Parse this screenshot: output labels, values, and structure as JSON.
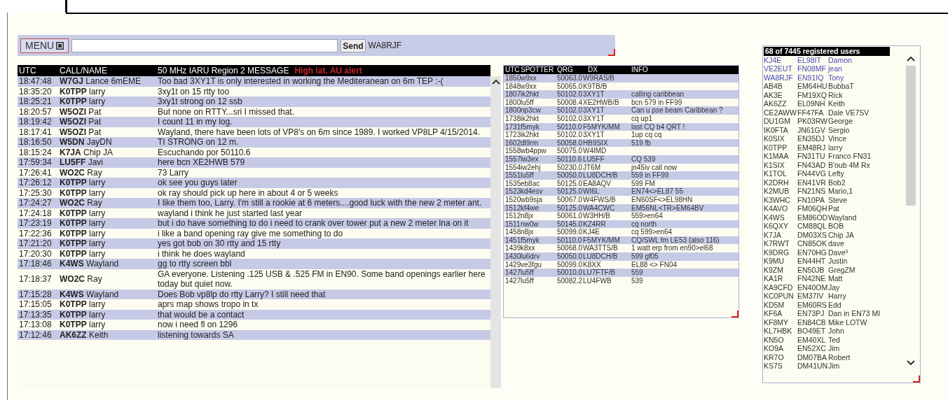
{
  "toolbar": {
    "menu_label": "MENU",
    "send_label": "Send",
    "callsign": "WA8RJF"
  },
  "chat": {
    "columns": [
      "UTC",
      "CALL/NAME",
      "50 MHz IARU Region 2 MESSAGE"
    ],
    "alert": "High lat. AU alert",
    "rows": [
      {
        "utc": "18:47:48",
        "call": "W7GJ",
        "name": "Lance 6mEME",
        "message": "Too bad 3XY1T is only interested in working the Mediteranean on 6m TEP :-("
      },
      {
        "utc": "18:35:20",
        "call": "K0TPP",
        "name": "larry",
        "message": "3xy1t on 15 rtty too"
      },
      {
        "utc": "18:25:21",
        "call": "K0TPP",
        "name": "larry",
        "message": "3xy1t strong on 12 ssb"
      },
      {
        "utc": "18:20:57",
        "call": "W5OZI",
        "name": "Pat",
        "message": "But none on RTTY...sri I missed that."
      },
      {
        "utc": "18:19:42",
        "call": "W5OZI",
        "name": "Pat",
        "message": "I count 11 in my log."
      },
      {
        "utc": "18:17:41",
        "call": "W5OZI",
        "name": "Pat",
        "message": "Wayland, there have been lots of VP8's on 6m since 1989. I worked VP8LP 4/15/2014."
      },
      {
        "utc": "18:16:50",
        "call": "W5DN",
        "name": "JayDN",
        "message": "TI STRONG on 12 m."
      },
      {
        "utc": "18:15:24",
        "call": "K7JA",
        "name": "Chip JA",
        "message": "Escuchando por 50110.6"
      },
      {
        "utc": "17:59:34",
        "call": "LU5FF",
        "name": "Javi",
        "message": "here bcn XE2HWB 579"
      },
      {
        "utc": "17:26:41",
        "call": "WO2C",
        "name": "Ray",
        "message": "73 Larry"
      },
      {
        "utc": "17:26:12",
        "call": "K0TPP",
        "name": "larry",
        "message": "ok see you guys later"
      },
      {
        "utc": "17:25:30",
        "call": "K0TPP",
        "name": "larry",
        "message": "ok ray should pick up here in about 4 or 5 weeks"
      },
      {
        "utc": "17:24:27",
        "call": "WO2C",
        "name": "Ray",
        "message": "I like them too, Larry. I'm still a rookie at 6 meters....good luck with the new 2 meter ant."
      },
      {
        "utc": "17:24:18",
        "call": "K0TPP",
        "name": "larry",
        "message": "wayland i think he just started last year"
      },
      {
        "utc": "17:23:19",
        "call": "K0TPP",
        "name": "larry",
        "message": "but i do have something to do i need to crank over tower put a new 2 meter lna on it"
      },
      {
        "utc": "17:22:36",
        "call": "K0TPP",
        "name": "larry",
        "message": "i like a band opening ray give me something to do"
      },
      {
        "utc": "17:21:20",
        "call": "K0TPP",
        "name": "larry",
        "message": "yes got bob on 30 rtty and 15 rtty"
      },
      {
        "utc": "17:20:30",
        "call": "K0TPP",
        "name": "larry",
        "message": "i think he does wayland"
      },
      {
        "utc": "17:18:46",
        "call": "K4WS",
        "name": "Wayland",
        "message": "gg to rtty screen bbl"
      },
      {
        "utc": "17:18:37",
        "call": "WO2C",
        "name": "Ray",
        "message": "GA everyone. Listening .125 USB & .525 FM in EN90. Some band openings earlier here today but quiet now."
      },
      {
        "utc": "17:15:28",
        "call": "K4WS",
        "name": "Wayland",
        "message": "Does Bob vp8lp do rtty Larry? I still need that"
      },
      {
        "utc": "17:15:05",
        "call": "K0TPP",
        "name": "larry",
        "message": "aprs map shows tropo in tx"
      },
      {
        "utc": "17:13:35",
        "call": "K0TPP",
        "name": "larry",
        "message": "that would be a contact"
      },
      {
        "utc": "17:13:08",
        "call": "K0TPP",
        "name": "larry",
        "message": "now i need fl on 1296"
      },
      {
        "utc": "17:12:46",
        "call": "AK6ZZ",
        "name": "Keith",
        "message": "listening towards SA"
      }
    ]
  },
  "spots": {
    "columns": [
      "UTC",
      "SPOTTER",
      "QRG",
      "DX",
      "INFO"
    ],
    "rows": [
      {
        "utc": "1850",
        "spotter": "w9xx",
        "qrg": "50063.0",
        "dx": "W9RAS/B",
        "info": ""
      },
      {
        "utc": "1848",
        "spotter": "w9xx",
        "qrg": "50065.0",
        "dx": "K9TB/B",
        "info": ""
      },
      {
        "utc": "1807",
        "spotter": "ik2hkt",
        "qrg": "50102.0",
        "dx": "3XY1T",
        "info": "calling caribbean"
      },
      {
        "utc": "1800",
        "spotter": "lu5ff",
        "qrg": "50008.4",
        "dx": "XE2HWB/B",
        "info": "bcn 579 in FF99"
      },
      {
        "utc": "1800",
        "spotter": "np3cw",
        "qrg": "50102.0",
        "dx": "3XY1T",
        "info": "Can u pse beam Caribbean ?"
      },
      {
        "utc": "1738",
        "spotter": "ik2hkt",
        "qrg": "50102.0",
        "dx": "3XY1T",
        "info": "cq up1"
      },
      {
        "utc": "1731",
        "spotter": "f5myk",
        "qrg": "50110.0",
        "dx": "F5MYK/MM",
        "info": "last CQ b4 QRT !"
      },
      {
        "utc": "1723",
        "spotter": "ik2hkt",
        "qrg": "50102.0",
        "dx": "3XY1T",
        "info": "1up cq cq"
      },
      {
        "utc": "1602",
        "spotter": "dl9rm",
        "qrg": "50058.0",
        "dx": "HB9SIX",
        "info": "519 fb"
      },
      {
        "utc": "1558",
        "spotter": "wb4ppw",
        "qrg": "50075.0",
        "dx": "W4IMD",
        "info": ""
      },
      {
        "utc": "1557",
        "spotter": "lw3ex",
        "qrg": "50110.6",
        "dx": "LU5FF",
        "info": "CQ 539"
      },
      {
        "utc": "1554",
        "spotter": "iw2ehj",
        "qrg": "50230.0",
        "dx": "JT6M",
        "info": "jn45iv call now"
      },
      {
        "utc": "1551",
        "spotter": "lu5ff",
        "qrg": "50050.0",
        "dx": "LU8DCH/B",
        "info": "559 in FF99"
      },
      {
        "utc": "1535",
        "spotter": "eb8ac",
        "qrg": "50125.0",
        "dx": "EA8AQV",
        "info": "599 FM"
      },
      {
        "utc": "1523",
        "spotter": "kd4esv",
        "qrg": "50125.0",
        "dx": "WI6L",
        "info": "EN74<>EL87 55"
      },
      {
        "utc": "1520",
        "spotter": "wb9sja",
        "qrg": "50067.0",
        "dx": "W4FWS/B",
        "info": "EN60SF<>EL98HN"
      },
      {
        "utc": "1512",
        "spotter": "kf4we",
        "qrg": "50125.0",
        "dx": "WA4CWC",
        "info": "EM56NL<TR>EM64BV"
      },
      {
        "utc": "1512",
        "spotter": "n8jx",
        "qrg": "50061.0",
        "dx": "W3HH/B",
        "info": "559>en64"
      },
      {
        "utc": "1511",
        "spotter": "nw0w",
        "qrg": "50145.0",
        "dx": "KZ4RR",
        "info": "cq north"
      },
      {
        "utc": "1458",
        "spotter": "n8jx",
        "qrg": "50099.0",
        "dx": "KJ4E",
        "info": "cq 599>en64"
      },
      {
        "utc": "1451",
        "spotter": "f5myk",
        "qrg": "50110.0",
        "dx": "F5MYK/MM",
        "info": "CQ/SWL fm LE53 (also 116)"
      },
      {
        "utc": "1439",
        "spotter": "k8xx",
        "qrg": "50068.0",
        "dx": "WA3TTS/B",
        "info": "1 watt erp from en90>el68"
      },
      {
        "utc": "1430",
        "spotter": "lu6drv",
        "qrg": "50050.0",
        "dx": "LU8DCH/B",
        "info": "599 gf05"
      },
      {
        "utc": "1429",
        "spotter": "ve3fgu",
        "qrg": "50099.0",
        "dx": "K8XX",
        "info": "EL88 <> FN04"
      },
      {
        "utc": "1427",
        "spotter": "lu5ff",
        "qrg": "50010.0",
        "dx": "LU7FTF/B",
        "info": "559"
      },
      {
        "utc": "1427",
        "spotter": "lu5ff",
        "qrg": "50082.2",
        "dx": "LU4FWB",
        "info": "539"
      }
    ]
  },
  "users": {
    "title": "68 of 7445 registered users",
    "rows": [
      {
        "call": "KJ4E",
        "grid": "EL98IT",
        "name": "Damon",
        "highlighted": true
      },
      {
        "call": "VE2EUT",
        "grid": "FN08MF",
        "name": "jean",
        "highlighted": true
      },
      {
        "call": "WA8RJF",
        "grid": "EN91IQ",
        "name": "Tony",
        "highlighted": true
      },
      {
        "call": "AB4B",
        "grid": "EM64HU",
        "name": "BubbaT",
        "highlighted": false
      },
      {
        "call": "AK3E",
        "grid": "FM19XQ",
        "name": "Rick",
        "highlighted": false
      },
      {
        "call": "AK6ZZ",
        "grid": "EL09NH",
        "name": "Keith",
        "highlighted": false
      },
      {
        "call": "CE2AWW",
        "grid": "FF47FA",
        "name": "Dale VE7SV",
        "highlighted": false
      },
      {
        "call": "DU1GM",
        "grid": "PK03RW",
        "name": "George",
        "highlighted": false
      },
      {
        "call": "IK0FTA",
        "grid": "JN61GV",
        "name": "Sergio",
        "highlighted": false
      },
      {
        "call": "K0SIX",
        "grid": "EN35DJ",
        "name": "Vince",
        "highlighted": false
      },
      {
        "call": "K0TPP",
        "grid": "EM48RJ",
        "name": "larry",
        "highlighted": false
      },
      {
        "call": "K1MAA",
        "grid": "FN31TU",
        "name": "Franco FN31",
        "highlighted": false
      },
      {
        "call": "K1SIX",
        "grid": "FN43AD",
        "name": "B'oub 4M Rx",
        "highlighted": false
      },
      {
        "call": "K1TOL",
        "grid": "FN44VG",
        "name": "Lefty",
        "highlighted": false
      },
      {
        "call": "K2DRH",
        "grid": "EN41VR",
        "name": "Bob2",
        "highlighted": false
      },
      {
        "call": "K2MUB",
        "grid": "FN21NS",
        "name": "Mario,1",
        "highlighted": false
      },
      {
        "call": "K3WHC",
        "grid": "FN10PA",
        "name": "Steve",
        "highlighted": false
      },
      {
        "call": "K4AVO",
        "grid": "FM06QH",
        "name": "Pat",
        "highlighted": false
      },
      {
        "call": "K4WS",
        "grid": "EM86OD",
        "name": "Wayland",
        "highlighted": false
      },
      {
        "call": "K6QXY",
        "grid": "CM88QL",
        "name": "BOB",
        "highlighted": false
      },
      {
        "call": "K7JA",
        "grid": "DM03XS",
        "name": "Chip JA",
        "highlighted": false
      },
      {
        "call": "K7RWT",
        "grid": "CN85OK",
        "name": "dave",
        "highlighted": false
      },
      {
        "call": "K9DRG",
        "grid": "EN70HG",
        "name": "Dave³",
        "highlighted": false
      },
      {
        "call": "K9MU",
        "grid": "EN44HT",
        "name": "Justin",
        "highlighted": false
      },
      {
        "call": "K9ZM",
        "grid": "EN50JB",
        "name": "GregZM",
        "highlighted": false
      },
      {
        "call": "KA1R",
        "grid": "FN42NE",
        "name": "Matt",
        "highlighted": false
      },
      {
        "call": "KA9CFD",
        "grid": "EN40OM",
        "name": "Jay",
        "highlighted": false
      },
      {
        "call": "KC0PUN",
        "grid": "EM37IV",
        "name": "Harry",
        "highlighted": false
      },
      {
        "call": "KD5M",
        "grid": "EM60RS",
        "name": "Edd",
        "highlighted": false
      },
      {
        "call": "KF6A",
        "grid": "EN73PJ",
        "name": "Dan in EN73 MI",
        "highlighted": false
      },
      {
        "call": "KF8MY",
        "grid": "EN84CB",
        "name": "Mike LOTW",
        "highlighted": false
      },
      {
        "call": "KL7HBK",
        "grid": "BO49ET",
        "name": "John",
        "highlighted": false
      },
      {
        "call": "KN5O",
        "grid": "EM40XL",
        "name": "Ted",
        "highlighted": false
      },
      {
        "call": "KO9A",
        "grid": "EN52XC",
        "name": "Jim",
        "highlighted": false
      },
      {
        "call": "KR7O",
        "grid": "DM07BA",
        "name": "Robert",
        "highlighted": false
      },
      {
        "call": "KS7S",
        "grid": "DM41UN",
        "name": "Jim",
        "highlighted": false
      }
    ]
  }
}
